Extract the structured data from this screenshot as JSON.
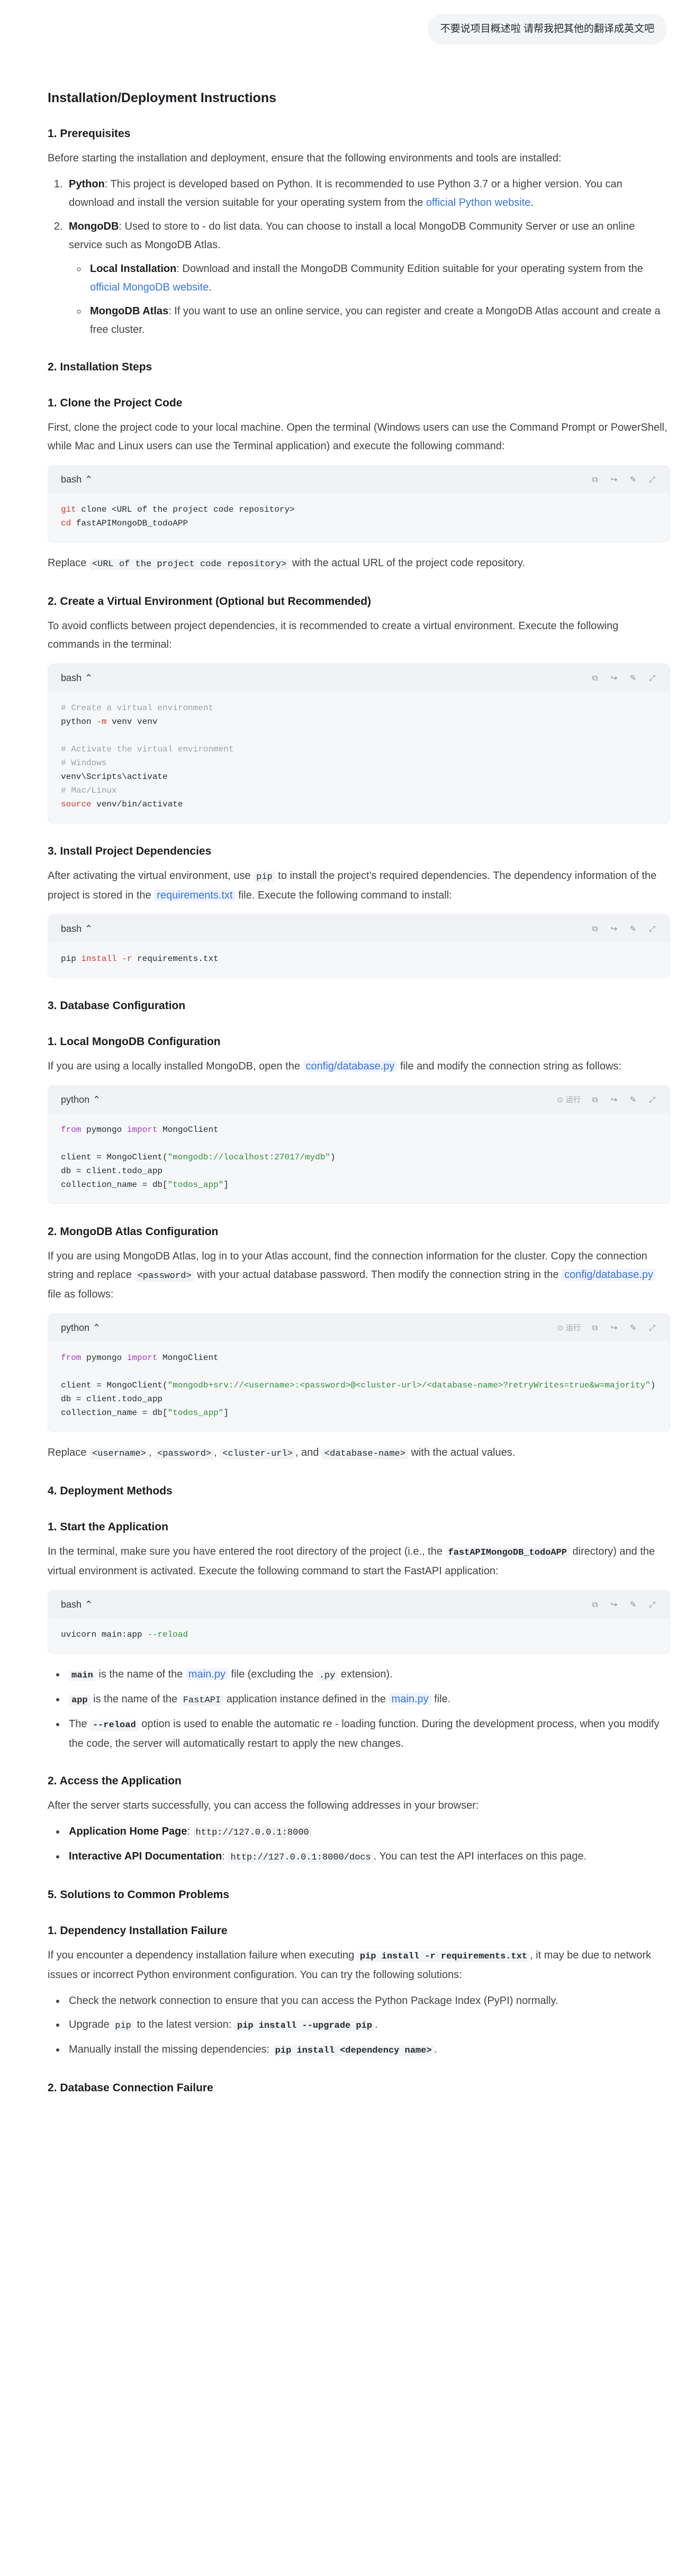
{
  "user_message": "不要说项目概述啦 请帮我把其他的翻译成英文吧",
  "run_label": "运行",
  "title": "Installation/Deployment Instructions",
  "s1": {
    "heading": "1. Prerequisites",
    "intro": "Before starting the installation and deployment, ensure that the following environments and tools are installed:",
    "python_label": "Python",
    "python_text": ": This project is developed based on Python. It is recommended to use Python 3.7 or a higher version. You can download and install the version suitable for your operating system from the ",
    "python_link": "official Python website",
    "mongodb_label": "MongoDB",
    "mongodb_text": ": Used to store to - do list data. You can choose to install a local MongoDB Community Server or use an online service such as MongoDB Atlas.",
    "local_label": "Local Installation",
    "local_text": ": Download and install the MongoDB Community Edition suitable for your operating system from the ",
    "local_link": "official MongoDB website",
    "atlas_label": "MongoDB Atlas",
    "atlas_text": ": If you want to use an online service, you can register and create a MongoDB Atlas account and create a free cluster."
  },
  "s2": {
    "heading": "2. Installation Steps",
    "clone_heading": "1. Clone the Project Code",
    "clone_text": "First, clone the project code to your local machine. Open the terminal (Windows users can use the Command Prompt or PowerShell, while Mac and Linux users can use the Terminal application) and execute the following command:",
    "clone_lang": "bash",
    "replace_prefix": "Replace ",
    "replace_code": "<URL of the project code repository>",
    "replace_suffix": " with the actual URL of the project code repository.",
    "venv_heading": "2. Create a Virtual Environment (Optional but Recommended)",
    "venv_text": "To avoid conflicts between project dependencies, it is recommended to create a virtual environment. Execute the following commands in the terminal:",
    "venv_lang": "bash",
    "deps_heading": "3. Install Project Dependencies",
    "deps_text_a": "After activating the virtual environment, use ",
    "deps_code": "pip",
    "deps_text_b": " to install the project's required dependencies. The dependency information of the project is stored in the ",
    "deps_file": "requirements.txt",
    "deps_text_c": " file. Execute the following command to install:",
    "deps_lang": "bash"
  },
  "s3": {
    "heading": "3. Database Configuration",
    "local_heading": "1. Local MongoDB Configuration",
    "local_text_a": "If you are using a locally installed MongoDB, open the ",
    "local_file": "config/database.py",
    "local_text_b": " file and modify the connection string as follows:",
    "local_lang": "python",
    "atlas_heading": "2. MongoDB Atlas Configuration",
    "atlas_text_a": "If you are using MongoDB Atlas, log in to your Atlas account, find the connection information for the cluster. Copy the connection string and replace ",
    "atlas_code": "<password>",
    "atlas_text_b": " with your actual database password. Then modify the connection string in the ",
    "atlas_file": "config/database.py",
    "atlas_text_c": " file as follows:",
    "atlas_lang": "python",
    "replace_a": "Replace ",
    "code1": "<username>",
    "sep1": ", ",
    "code2": "<password>",
    "sep2": ", ",
    "code3": "<cluster-url>",
    "sep3": ", and ",
    "code4": "<database-name>",
    "replace_b": " with the actual values."
  },
  "s4": {
    "heading": "4. Deployment Methods",
    "start_heading": "1. Start the Application",
    "start_text_a": "In the terminal, make sure you have entered the root directory of the project (i.e., the ",
    "start_code": "fastAPIMongoDB_todoAPP",
    "start_text_b": " directory) and the virtual environment is activated. Execute the following command to start the FastAPI application:",
    "start_lang": "bash",
    "b1_code": "main",
    "b1_text_a": " is the name of the ",
    "b1_file": "main.py",
    "b1_text_b": " file (excluding the ",
    "b1_code2": ".py",
    "b1_text_c": " extension).",
    "b2_code": "app",
    "b2_text_a": " is the name of the ",
    "b2_code2": "FastAPI",
    "b2_text_b": " application instance defined in the ",
    "b2_file": "main.py",
    "b2_text_c": " file.",
    "b3_text_a": "The ",
    "b3_code": "--reload",
    "b3_text_b": " option is used to enable the automatic re - loading function. During the development process, when you modify the code, the server will automatically restart to apply the new changes.",
    "access_heading": "2. Access the Application",
    "access_text": "After the server starts successfully, you can access the following addresses in your browser:",
    "home_label": "Application Home Page",
    "home_sep": ": ",
    "home_url": "http://127.0.0.1:8000",
    "docs_label": "Interactive API Documentation",
    "docs_sep": ": ",
    "docs_url": "http://127.0.0.1:8000/docs",
    "docs_text": ". You can test the API interfaces on this page."
  },
  "s5": {
    "heading": "5. Solutions to Common Problems",
    "dep_heading": "1. Dependency Installation Failure",
    "dep_text_a": "If you encounter a dependency installation failure when executing ",
    "dep_code": "pip install -r requirements.txt",
    "dep_text_b": ", it may be due to network issues or incorrect Python environment configuration. You can try the following solutions:",
    "li1": "Check the network connection to ensure that you can access the Python Package Index (PyPI) normally.",
    "li2_a": "Upgrade ",
    "li2_code": "pip",
    "li2_b": " to the latest version: ",
    "li2_code2": "pip install --upgrade pip",
    "li2_c": ".",
    "li3_a": "Manually install the missing dependencies: ",
    "li3_code": "pip install <dependency name>",
    "li3_b": ".",
    "db_heading": "2. Database Connection Failure"
  },
  "code": {
    "clone_l1_a": "git",
    "clone_l1_b": " clone <URL of the project code repository>",
    "clone_l2_a": "cd",
    "clone_l2_b": " fastAPIMongoDB_todoAPP",
    "venv_c1": "# Create a virtual environment",
    "venv_l1_a": "python ",
    "venv_l1_b": "-m",
    "venv_l1_c": " venv venv",
    "venv_c2": "# Activate the virtual environment",
    "venv_c3": "# Windows",
    "venv_l2": "venv\\Scripts\\activate",
    "venv_c4": "# Mac/Linux",
    "venv_l3_a": "source",
    "venv_l3_b": " venv/bin/activate",
    "deps_a": "pip ",
    "deps_b": "install",
    "deps_c": " ",
    "deps_d": "-r",
    "deps_e": " requirements.txt",
    "py_from": "from",
    "py_mod": " pymongo ",
    "py_import": "import",
    "py_cls": " MongoClient",
    "local_client_a": "client = MongoClient(",
    "local_client_str": "\"mongodb://localhost:27017/mydb\"",
    "local_client_b": ")",
    "db_line": "db = client.todo_app",
    "coll_a": "collection_name = db[",
    "coll_str": "\"todos_app\"",
    "coll_b": "]",
    "atlas_client_a": "client = MongoClient(",
    "atlas_client_str": "\"mongodb+srv://<username>:<password>@<cluster-url>/<database-name>?retryWrites=true&w=majority\"",
    "atlas_client_b": ")",
    "uv_a": "uvicorn main:app ",
    "uv_b": "--reload"
  },
  "colors": {
    "link": "#3b72e0",
    "keyword": "#d1392f",
    "import_keyword": "#a240c4",
    "string": "#2f8f3a",
    "comment": "#9ca0a8"
  }
}
